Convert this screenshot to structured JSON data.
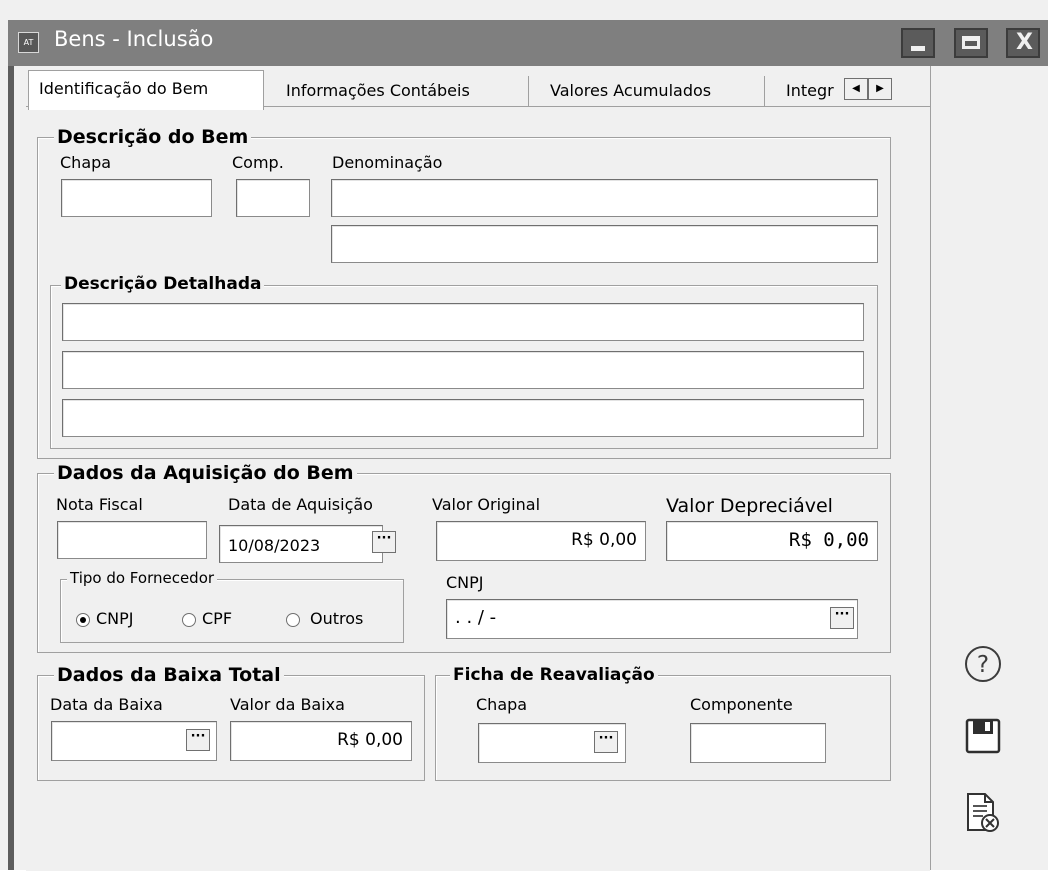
{
  "window": {
    "icon_text": "AT",
    "title": "Bens - Inclusão",
    "min_icon": "minimize-icon",
    "max_icon": "maximize-icon",
    "close_icon": "close-icon",
    "close_glyph": "X"
  },
  "tabs": [
    {
      "label": "Identificação do Bem",
      "active": true
    },
    {
      "label": "Informações Contábeis",
      "active": false
    },
    {
      "label": "Valores Acumulados",
      "active": false
    },
    {
      "label": "Integr",
      "active": false
    }
  ],
  "tab_scroll": {
    "left_glyph": "◀",
    "right_glyph": "▶"
  },
  "descricao": {
    "legend": "Descrição  do Bem",
    "chapa_label": "Chapa",
    "comp_label": "Comp.",
    "denominacao_label": "Denominação",
    "chapa_value": "",
    "comp_value": "",
    "denominacao_line1": "",
    "denominacao_line2": "",
    "detalhada_legend": "Descrição Detalhada",
    "detalhada_lines": [
      "",
      "",
      ""
    ]
  },
  "aquisicao": {
    "legend": "Dados da Aquisição do Bem",
    "nota_label": "Nota Fiscal",
    "data_label": "Data de Aquisição",
    "valor_original_label": "Valor Original",
    "valor_depreciavel_label": "Valor Depreciável",
    "nota_value": "",
    "data_value": "10/08/2023",
    "valor_original_value": "R$ 0,00",
    "valor_depreciavel_value": "R$ 0,00",
    "tipo_legend": "Tipo do Fornecedor",
    "tipo_options": [
      "CNPJ",
      "CPF",
      "Outros"
    ],
    "tipo_selected": "CNPJ",
    "cnpj_label": "CNPJ",
    "cnpj_value": " .  .  /  -"
  },
  "baixa": {
    "legend": "Dados da Baixa Total",
    "data_label": "Data da Baixa",
    "valor_label": "Valor da Baixa",
    "data_value": "",
    "valor_value": "R$ 0,00"
  },
  "reavaliacao": {
    "legend": "Ficha de Reavaliação",
    "chapa_label": "Chapa",
    "componente_label": "Componente",
    "chapa_value": "",
    "componente_value": ""
  },
  "ellipsis_glyph": "···",
  "side_actions": [
    {
      "name": "help-icon"
    },
    {
      "name": "save-icon"
    },
    {
      "name": "cancel-document-icon"
    }
  ]
}
